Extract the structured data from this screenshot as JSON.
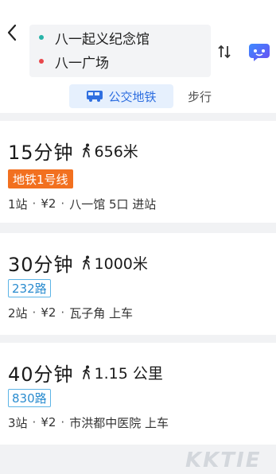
{
  "header": {
    "origin": "八一起义纪念馆",
    "destination": "八一广场",
    "origin_dot_color": "#27b3a8",
    "destination_dot_color": "#e8474b"
  },
  "icons": {
    "back": "chevron-left-icon",
    "swap": "swap-vertical-icon",
    "assistant": "chat-bubble-icon",
    "bus": "bus-icon",
    "walk": "walking-person-icon"
  },
  "tabs": {
    "transit_label": "公交地铁",
    "walk_label": "步行",
    "active": "transit"
  },
  "routes": [
    {
      "duration": "15分钟",
      "walk": "656米",
      "line": "地铁1号线",
      "line_type": "metro",
      "stops": "1站",
      "price": "¥2",
      "boarding": "八一馆 5口 进站"
    },
    {
      "duration": "30分钟",
      "walk": "1000米",
      "line": "232路",
      "line_type": "bus",
      "stops": "2站",
      "price": "¥2",
      "boarding": "瓦子角 上车"
    },
    {
      "duration": "40分钟",
      "walk": "1.15 公里",
      "line": "830路",
      "line_type": "bus",
      "stops": "3站",
      "price": "¥2",
      "boarding": "市洪都中医院 上车"
    }
  ],
  "watermark": "KKTIE",
  "colors": {
    "accent": "#2f6fe0",
    "metro_badge": "#f2701f",
    "bus_badge_border": "#5cb4e6"
  }
}
